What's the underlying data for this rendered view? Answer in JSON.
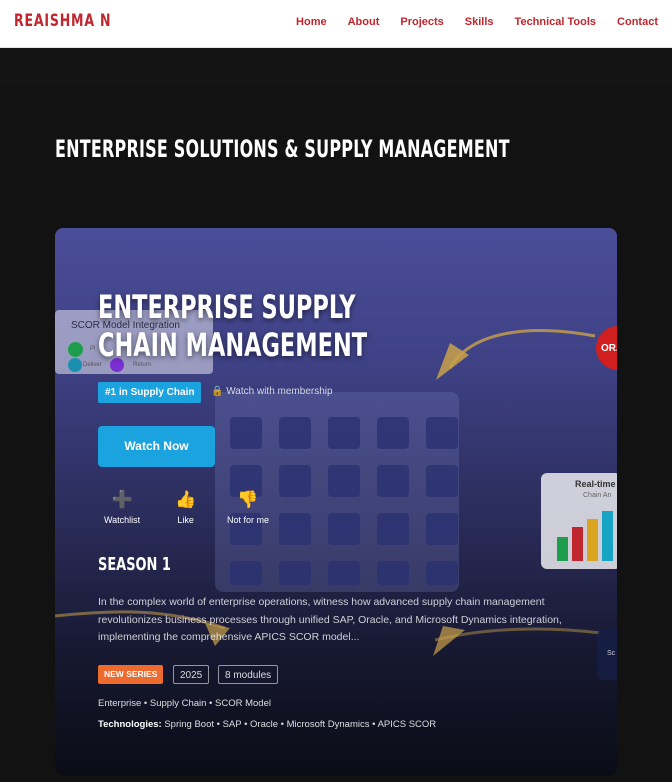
{
  "nav": {
    "logo": "REAISHMA N",
    "links": [
      "Home",
      "About",
      "Projects",
      "Skills",
      "Technical Tools",
      "Contact"
    ]
  },
  "section": {
    "title": "ENTERPRISE SOLUTIONS & SUPPLY MANAGEMENT"
  },
  "card": {
    "title": "ENTERPRISE SUPPLY CHAIN MANAGEMENT",
    "rank_badge": "#1 in Supply Chain",
    "membership": "🔒 Watch with membership",
    "watch_button": "Watch Now",
    "actions": [
      {
        "icon": "plus-icon",
        "glyph": "➕",
        "label": "Watchlist"
      },
      {
        "icon": "thumbs-up-icon",
        "glyph": "👍",
        "label": "Like"
      },
      {
        "icon": "thumbs-down-icon",
        "glyph": "👎",
        "label": "Not for me"
      }
    ],
    "season": "SEASON 1",
    "description": "In the complex world of enterprise operations, witness how advanced supply chain management revolutionizes business processes through unified SAP, Oracle, and Microsoft Dynamics integration, implementing the comprehensive APICS SCOR model...",
    "tags": {
      "new": "NEW SERIES",
      "year": "2025",
      "modules": "8 modules"
    },
    "genres": "Enterprise • Supply Chain • SCOR Model",
    "tech_label": "Technologies:",
    "tech_list": " Spring Boot • SAP • Oracle • Microsoft Dynamics • APICS SCOR"
  },
  "background_art": {
    "scor_title": "SCOR Model Integration",
    "scor_left": "Deliver",
    "scor_right": "Return",
    "scor_tag": "Pl",
    "rt_title": "Real-time",
    "rt_sub": "Chain An",
    "ora": "ORA",
    "side_box": "Sc"
  },
  "colors": {
    "brand_red": "#c0262d",
    "accent_blue": "#1ba3e0",
    "new_orange": "#ee6b2f",
    "page_bg": "#121212"
  }
}
